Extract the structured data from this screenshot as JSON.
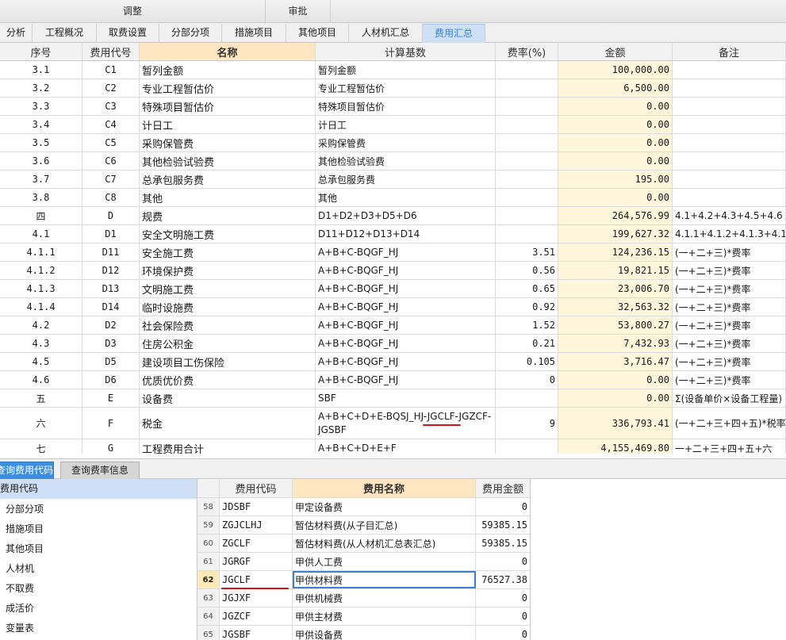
{
  "top_sections": {
    "adjust": "调整",
    "approve": "审批"
  },
  "tabs": [
    "分析",
    "工程概况",
    "取费设置",
    "分部分项",
    "措施项目",
    "其他项目",
    "人材机汇总",
    "费用汇总"
  ],
  "grid": {
    "headers": {
      "seq": "序号",
      "code": "费用代号",
      "name": "名称",
      "base": "计算基数",
      "rate": "费率(%)",
      "amount": "金额",
      "note": "备注"
    },
    "rows": [
      {
        "seq": "3.1",
        "code": "C1",
        "name": "暂列金额",
        "base": "暂列金额",
        "rate": "",
        "amount": "100,000.00",
        "note": ""
      },
      {
        "seq": "3.2",
        "code": "C2",
        "name": "专业工程暂估价",
        "base": "专业工程暂估价",
        "rate": "",
        "amount": "6,500.00",
        "note": ""
      },
      {
        "seq": "3.3",
        "code": "C3",
        "name": "特殊项目暂估价",
        "base": "特殊项目暂估价",
        "rate": "",
        "amount": "0.00",
        "note": ""
      },
      {
        "seq": "3.4",
        "code": "C4",
        "name": "计日工",
        "base": "计日工",
        "rate": "",
        "amount": "0.00",
        "note": ""
      },
      {
        "seq": "3.5",
        "code": "C5",
        "name": "采购保管费",
        "base": "采购保管费",
        "rate": "",
        "amount": "0.00",
        "note": ""
      },
      {
        "seq": "3.6",
        "code": "C6",
        "name": "其他检验试验费",
        "base": "其他检验试验费",
        "rate": "",
        "amount": "0.00",
        "note": ""
      },
      {
        "seq": "3.7",
        "code": "C7",
        "name": "总承包服务费",
        "base": "总承包服务费",
        "rate": "",
        "amount": "195.00",
        "note": ""
      },
      {
        "seq": "3.8",
        "code": "C8",
        "name": "其他",
        "base": "其他",
        "rate": "",
        "amount": "0.00",
        "note": ""
      },
      {
        "seq": "四",
        "code": "D",
        "name": "规费",
        "base": "D1+D2+D3+D5+D6",
        "rate": "",
        "amount": "264,576.99",
        "note": "4.1+4.2+4.3+4.5+4.6"
      },
      {
        "seq": "4.1",
        "code": "D1",
        "name": "安全文明施工费",
        "base": "D11+D12+D13+D14",
        "rate": "",
        "amount": "199,627.32",
        "note": "4.1.1+4.1.2+4.1.3+4.1.4"
      },
      {
        "seq": "4.1.1",
        "code": "D11",
        "name": "安全施工费",
        "base": "A+B+C-BQGF_HJ",
        "rate": "3.51",
        "amount": "124,236.15",
        "note": "(一+二+三)*费率"
      },
      {
        "seq": "4.1.2",
        "code": "D12",
        "name": "环境保护费",
        "base": "A+B+C-BQGF_HJ",
        "rate": "0.56",
        "amount": "19,821.15",
        "note": "(一+二+三)*费率"
      },
      {
        "seq": "4.1.3",
        "code": "D13",
        "name": "文明施工费",
        "base": "A+B+C-BQGF_HJ",
        "rate": "0.65",
        "amount": "23,006.70",
        "note": "(一+二+三)*费率"
      },
      {
        "seq": "4.1.4",
        "code": "D14",
        "name": "临时设施费",
        "base": "A+B+C-BQGF_HJ",
        "rate": "0.92",
        "amount": "32,563.32",
        "note": "(一+二+三)*费率"
      },
      {
        "seq": "4.2",
        "code": "D2",
        "name": "社会保险费",
        "base": "A+B+C-BQGF_HJ",
        "rate": "1.52",
        "amount": "53,800.27",
        "note": "(一+二+三)*费率"
      },
      {
        "seq": "4.3",
        "code": "D3",
        "name": "住房公积金",
        "base": "A+B+C-BQGF_HJ",
        "rate": "0.21",
        "amount": "7,432.93",
        "note": "(一+二+三)*费率"
      },
      {
        "seq": "4.5",
        "code": "D5",
        "name": "建设项目工伤保险",
        "base": "A+B+C-BQGF_HJ",
        "rate": "0.105",
        "amount": "3,716.47",
        "note": "(一+二+三)*费率"
      },
      {
        "seq": "4.6",
        "code": "D6",
        "name": "优质优价费",
        "base": "A+B+C-BQGF_HJ",
        "rate": "0",
        "amount": "0.00",
        "note": "(一+二+三)*费率"
      },
      {
        "seq": "五",
        "code": "E",
        "name": "设备费",
        "base": "SBF",
        "rate": "",
        "amount": "0.00",
        "note": "Σ(设备单价×设备工程量)"
      },
      {
        "seq": "六",
        "code": "F",
        "name": "税金",
        "base": "A+B+C+D+E-BQSJ_HJ-JGCLF-JGZCF-JGSBF",
        "rate": "9",
        "amount": "336,793.41",
        "note": "(一+二+三+四+五)*税率"
      },
      {
        "seq": "七",
        "code": "G",
        "name": "工程费用合计",
        "base": "A+B+C+D+E+F",
        "rate": "",
        "amount": "4,155,469.80",
        "note": "一+二+三+四+五+六"
      }
    ]
  },
  "bottom_tabs": [
    "查询费用代码",
    "查询费率信息"
  ],
  "code_tree": [
    "费用代码",
    "分部分项",
    "措施项目",
    "其他项目",
    "人材机",
    "不取费",
    "成活价",
    "变量表"
  ],
  "code_table": {
    "headers": {
      "code": "费用代码",
      "name": "费用名称",
      "amount": "费用金额"
    },
    "rows": [
      {
        "num": "58",
        "code": "JDSBF",
        "name": "甲定设备费",
        "amount": "0"
      },
      {
        "num": "59",
        "code": "ZGJCLHJ",
        "name": "暂估材料费(从子目汇总)",
        "amount": "59385.15"
      },
      {
        "num": "60",
        "code": "ZGCLF",
        "name": "暂估材料费(从人材机汇总表汇总)",
        "amount": "59385.15"
      },
      {
        "num": "61",
        "code": "JGRGF",
        "name": "甲供人工费",
        "amount": "0"
      },
      {
        "num": "62",
        "code": "JGCLF",
        "name": "甲供材料费",
        "amount": "76527.38"
      },
      {
        "num": "63",
        "code": "JGJXF",
        "name": "甲供机械费",
        "amount": "0"
      },
      {
        "num": "64",
        "code": "JGZCF",
        "name": "甲供主材费",
        "amount": "0"
      },
      {
        "num": "65",
        "code": "JGSBF",
        "name": "甲供设备费",
        "amount": "0"
      }
    ],
    "selected_num": "62"
  },
  "colors": {
    "accent": "#3d7fd1",
    "amount_bg": "#fdf6da",
    "header_highlight": "#fde7c3",
    "annotation": "#dd1111"
  }
}
